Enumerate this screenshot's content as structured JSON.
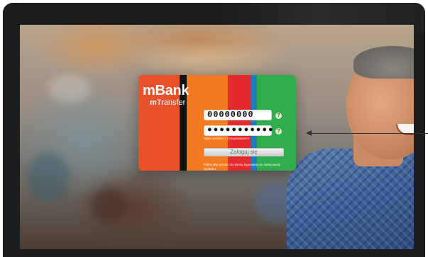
{
  "brand": {
    "name": "mBank",
    "product_prefix": "m",
    "product_suffix": "Transfer"
  },
  "login_form": {
    "login_value": "00000000",
    "password_mask": "●●●●●●●●●●●",
    "help_icon_glyph": "?",
    "forgot_text": "Masz problem z zalogowaniem?",
    "submit_label": "Zaloguj się",
    "info_text": "Kliknij aby przejść do strony logowania do starej wersji systemu"
  },
  "colors": {
    "orange": "#e8512a",
    "black": "#111111",
    "light_orange": "#f27a1f",
    "red": "#e52a2e",
    "blue": "#1f7ac0",
    "green": "#2fae4e"
  }
}
